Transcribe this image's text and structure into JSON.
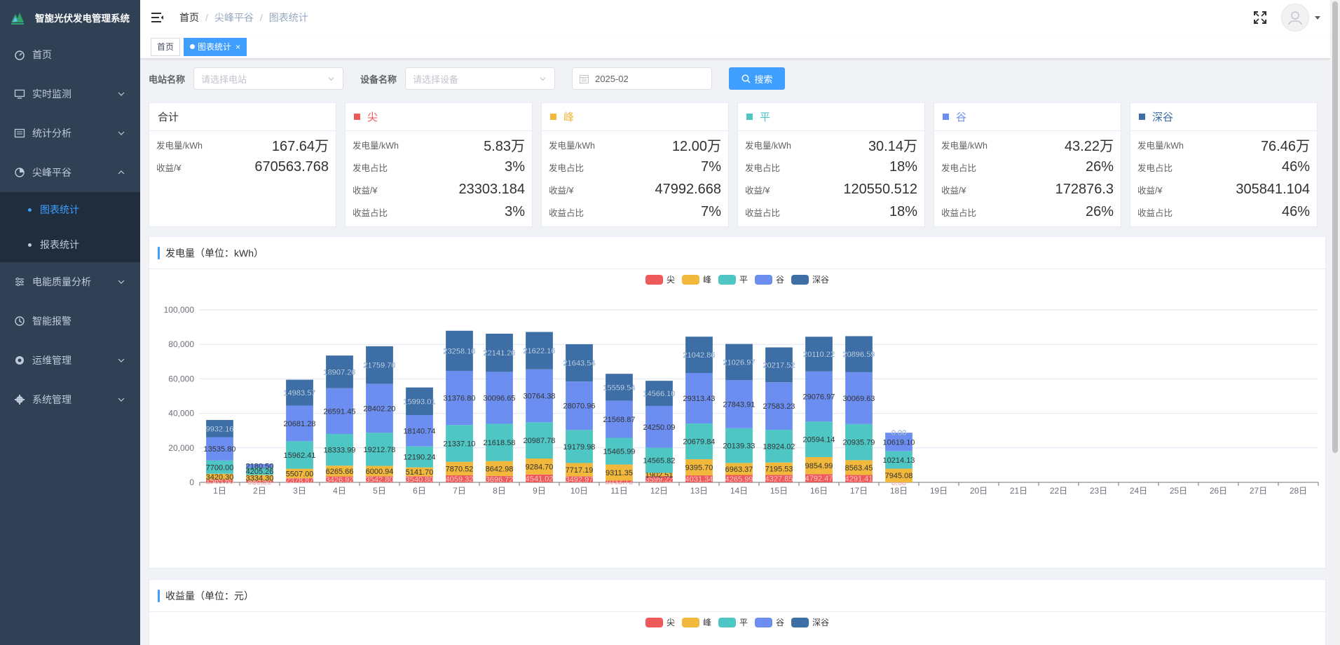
{
  "app": {
    "title": "智旎光伏发电管理系统"
  },
  "sidebar": {
    "items": [
      {
        "label": "首页",
        "icon": "dashboard-icon",
        "has_children": false
      },
      {
        "label": "实时监测",
        "icon": "monitor-icon",
        "has_children": true
      },
      {
        "label": "统计分析",
        "icon": "chart-icon",
        "has_children": true
      },
      {
        "label": "尖峰平谷",
        "icon": "analysis-icon",
        "has_children": true,
        "expanded": true
      },
      {
        "label": "电能质量分析",
        "icon": "sliders-icon",
        "has_children": true
      },
      {
        "label": "智能报警",
        "icon": "alarm-icon",
        "has_children": false
      },
      {
        "label": "运维管理",
        "icon": "tool-icon",
        "has_children": true
      },
      {
        "label": "系统管理",
        "icon": "gear-icon",
        "has_children": true
      }
    ],
    "subitems": [
      {
        "label": "图表统计",
        "active": true
      },
      {
        "label": "报表统计",
        "active": false
      }
    ]
  },
  "header": {
    "breadcrumb": [
      "首页",
      "尖峰平谷",
      "图表统计"
    ]
  },
  "tags": [
    {
      "label": "首页",
      "active": false
    },
    {
      "label": "图表统计",
      "active": true,
      "close": "×"
    }
  ],
  "filters": {
    "station_label": "电站名称",
    "station_placeholder": "请选择电站",
    "device_label": "设备名称",
    "device_placeholder": "请选择设备",
    "date_value": "2025-02",
    "search_label": "搜索"
  },
  "cards": [
    {
      "title": "合计",
      "color": "",
      "rows": [
        {
          "label": "发电量/kWh",
          "value": "167.64万"
        },
        {
          "label": "收益/¥",
          "value": "670563.768"
        }
      ]
    },
    {
      "title": "尖",
      "color": "#ee5a5a",
      "rows": [
        {
          "label": "发电量/kWh",
          "value": "5.83万"
        },
        {
          "label": "发电占比",
          "value": "3%"
        },
        {
          "label": "收益/¥",
          "value": "23303.184"
        },
        {
          "label": "收益占比",
          "value": "3%"
        }
      ]
    },
    {
      "title": "峰",
      "color": "#f2b83c",
      "rows": [
        {
          "label": "发电量/kWh",
          "value": "12.00万"
        },
        {
          "label": "发电占比",
          "value": "7%"
        },
        {
          "label": "收益/¥",
          "value": "47992.668"
        },
        {
          "label": "收益占比",
          "value": "7%"
        }
      ]
    },
    {
      "title": "平",
      "color": "#4ec6c4",
      "rows": [
        {
          "label": "发电量/kWh",
          "value": "30.14万"
        },
        {
          "label": "发电占比",
          "value": "18%"
        },
        {
          "label": "收益/¥",
          "value": "120550.512"
        },
        {
          "label": "收益占比",
          "value": "18%"
        }
      ]
    },
    {
      "title": "谷",
      "color": "#6b8ef0",
      "rows": [
        {
          "label": "发电量/kWh",
          "value": "43.22万"
        },
        {
          "label": "发电占比",
          "value": "26%"
        },
        {
          "label": "收益/¥",
          "value": "172876.3"
        },
        {
          "label": "收益占比",
          "value": "26%"
        }
      ]
    },
    {
      "title": "深谷",
      "color": "#3d6ea5",
      "rows": [
        {
          "label": "发电量/kWh",
          "value": "76.46万"
        },
        {
          "label": "发电占比",
          "value": "46%"
        },
        {
          "label": "收益/¥",
          "value": "305841.104"
        },
        {
          "label": "收益占比",
          "value": "46%"
        }
      ]
    }
  ],
  "panels": {
    "energy_title": "发电量（单位：kWh）",
    "revenue_title": "收益量（单位：元）"
  },
  "colors": {
    "accent": "#409eff",
    "sidebar_bg": "#304156",
    "submenu_bg": "#1f2d3d"
  },
  "chart_data": {
    "type": "bar",
    "stacked": true,
    "title": "发电量（单位：kWh）",
    "categories": [
      "1日",
      "2日",
      "3日",
      "4日",
      "5日",
      "6日",
      "7日",
      "8日",
      "9日",
      "10日",
      "11日",
      "12日",
      "13日",
      "14日",
      "15日",
      "16日",
      "17日",
      "18日",
      "19日",
      "20日",
      "21日",
      "22日",
      "23日",
      "24日",
      "25日",
      "26日",
      "27日",
      "28日"
    ],
    "ylim": [
      0,
      100000
    ],
    "yticks": [
      "0",
      "20,000",
      "40,000",
      "60,000",
      "80,000",
      "100,000"
    ],
    "legend_position": "top-center",
    "grid": true,
    "series": [
      {
        "name": "尖",
        "color": "#ee5a5a",
        "values": [
          1565.6,
          980.5,
          2378.87,
          3426.92,
          3542.8,
          3540.8,
          4059.32,
          3696.72,
          4541.02,
          3492.97,
          1032.72,
          3599.22,
          4031.34,
          4265.99,
          4327.85,
          4792.47,
          4291.41,
          0.0,
          null,
          null,
          null,
          null,
          null,
          null,
          null,
          null,
          null,
          null
        ],
        "labels": [
          "1565.60",
          "980.50",
          "2378.87",
          "3426.92",
          "3542.80",
          "3540.80",
          "4059.32",
          "3696.72",
          "4541.02",
          "3492.97",
          "1032.72",
          "3599.22",
          "4031.34",
          "4265.99",
          "4327.85",
          "4792.47",
          "4291.41",
          "0.00",
          "",
          "",
          "",
          "",
          "",
          "",
          "",
          "",
          "",
          ""
        ]
      },
      {
        "name": "峰",
        "color": "#f2b83c",
        "values": [
          3420.3,
          3334.3,
          5507.0,
          6265.66,
          6000.94,
          5141.7,
          7870.52,
          8642.98,
          9284.7,
          7717.19,
          9311.35,
          1902.51,
          9395.7,
          6963.37,
          7195.53,
          9854.99,
          8563.45,
          7945.08,
          null,
          null,
          null,
          null,
          null,
          null,
          null,
          null,
          null,
          null
        ],
        "labels": [
          "3420.30",
          "3334.30",
          "5507.00",
          "6265.66",
          "6000.94",
          "5141.70",
          "7870.52",
          "8642.98",
          "9284.70",
          "7717.19",
          "9311.35",
          "1902.51",
          "9395.70",
          "6963.37",
          "7195.53",
          "9854.99",
          "8563.45",
          "7945.08",
          "",
          "",
          "",
          "",
          "",
          "",
          "",
          "",
          "",
          ""
        ]
      },
      {
        "name": "平",
        "color": "#4ec6c4",
        "values": [
          7700.0,
          4205.26,
          15962.41,
          18333.99,
          19212.78,
          12190.24,
          21337.1,
          21618.58,
          20987.78,
          19179.98,
          15465.99,
          14565.82,
          20679.84,
          20139.33,
          18924.02,
          20594.14,
          20935.79,
          10214.13,
          null,
          null,
          null,
          null,
          null,
          null,
          null,
          null,
          null,
          null
        ],
        "labels": [
          "7700.00",
          "4205.26",
          "15962.41",
          "18333.99",
          "19212.78",
          "12190.24",
          "21337.10",
          "21618.58",
          "20987.78",
          "19179.98",
          "15465.99",
          "14565.82",
          "20679.84",
          "20139.33",
          "18924.02",
          "20594.14",
          "20935.79",
          "10214.13",
          "",
          "",
          "",
          "",
          "",
          "",
          "",
          "",
          "",
          ""
        ]
      },
      {
        "name": "谷",
        "color": "#6b8ef0",
        "values": [
          13535.8,
          2180.5,
          20681.28,
          26591.45,
          28402.2,
          18140.74,
          31376.8,
          30096.65,
          30764.38,
          28070.96,
          21568.87,
          24250.09,
          29313.43,
          27843.91,
          27583.23,
          29076.97,
          30069.63,
          10619.1,
          null,
          null,
          null,
          null,
          null,
          null,
          null,
          null,
          null,
          null
        ],
        "labels": [
          "13535.80",
          "2180.50",
          "20681.28",
          "26591.45",
          "28402.20",
          "18140.74",
          "31376.80",
          "30096.65",
          "30764.38",
          "28070.96",
          "21568.87",
          "24250.09",
          "29313.43",
          "27843.91",
          "27583.23",
          "29076.97",
          "30069.63",
          "10619.10",
          "",
          "",
          "",
          "",
          "",
          "",
          "",
          "",
          "",
          ""
        ]
      },
      {
        "name": "深谷",
        "color": "#3d6ea5",
        "values": [
          9932.16,
          0,
          14983.57,
          18907.26,
          21759.7,
          15993.01,
          23258.16,
          22141.26,
          21622.16,
          21643.54,
          15559.54,
          14566.1,
          21042.86,
          21026.97,
          20217.52,
          20110.22,
          20896.59,
          0.0,
          null,
          null,
          null,
          null,
          null,
          null,
          null,
          null,
          null,
          null
        ],
        "labels": [
          "9932.16",
          "",
          "14983.57",
          "18907.26",
          "21759.70",
          "15993.01",
          "23258.16",
          "22141.26",
          "21622.16",
          "21643.54",
          "15559.54",
          "14566.10",
          "21042.86",
          "21026.97",
          "20217.52",
          "20110.22",
          "20896.59",
          "0.00",
          "",
          "",
          "",
          "",
          "",
          "",
          "",
          "",
          "",
          ""
        ]
      }
    ]
  }
}
